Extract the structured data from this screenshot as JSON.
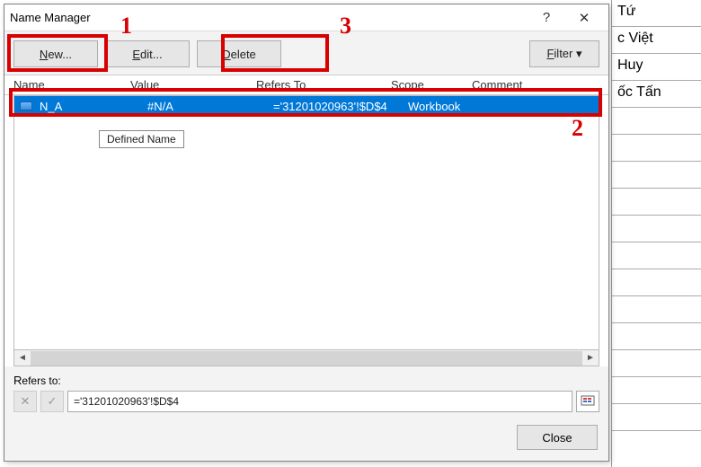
{
  "dialog": {
    "title": "Name Manager",
    "help_symbol": "?",
    "close_symbol": "✕"
  },
  "toolbar": {
    "new_label": "New...",
    "edit_label": "Edit...",
    "delete_label": "Delete",
    "filter_label": "Filter"
  },
  "columns": {
    "name": "Name",
    "value": "Value",
    "refers": "Refers To",
    "scope": "Scope",
    "comment": "Comment"
  },
  "rows": [
    {
      "name": "N_A",
      "value": "#N/A",
      "refers": "='31201020963'!$D$4",
      "scope": "Workbook",
      "comment": ""
    }
  ],
  "tooltip": "Defined Name",
  "refersto": {
    "label": "Refers to:",
    "value": "='31201020963'!$D$4",
    "cancel_glyph": "✕",
    "accept_glyph": "✓"
  },
  "footer": {
    "close": "Close"
  },
  "bg_cells": [
    "Tứ",
    "c Việt",
    "Huy",
    "ốc  Tấn",
    "",
    "",
    "",
    "",
    "",
    "",
    "",
    "",
    "",
    "",
    "",
    ""
  ],
  "scroll": {
    "left_glyph": "◄",
    "right_glyph": "►"
  },
  "annotations": {
    "n1": "1",
    "n2": "2",
    "n3": "3"
  },
  "filter_caret": "▾"
}
